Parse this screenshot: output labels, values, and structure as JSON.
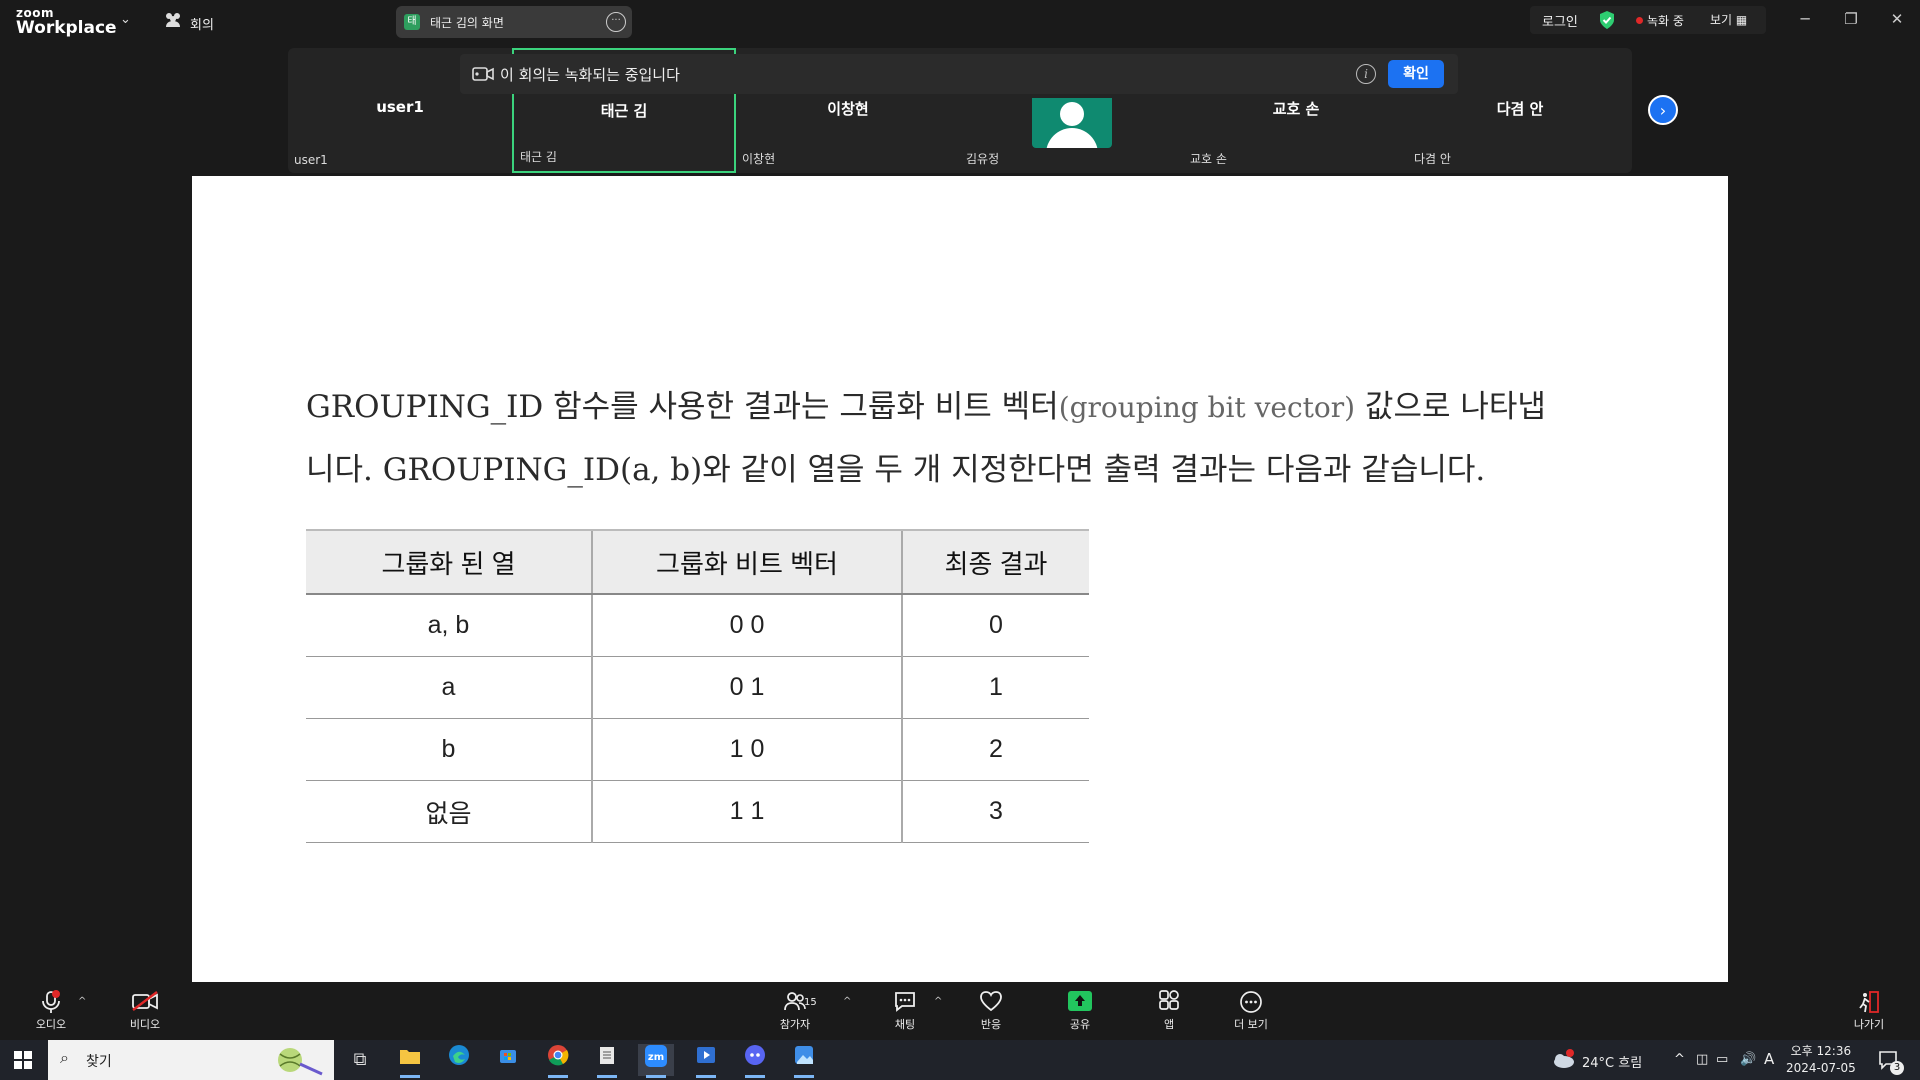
{
  "app": {
    "logo_top": "zoom",
    "logo_bottom": "Workplace",
    "meetings_label": "회의",
    "share_title": "태근 김의 화면",
    "share_badge": "태",
    "login": "로그인",
    "recording": "녹화 중",
    "view": "보기"
  },
  "participants": [
    {
      "name": "user1",
      "label": "user1"
    },
    {
      "name": "태근 김",
      "label": "태근 김"
    },
    {
      "name": "이창현",
      "label": "이창현"
    },
    {
      "name": "",
      "label": "김유정"
    },
    {
      "name": "교호 손",
      "label": "교호 손"
    },
    {
      "name": "다겸 안",
      "label": "다겸 안"
    }
  ],
  "banner": {
    "text": "이 회의는 녹화되는 중입니다",
    "confirm": "확인"
  },
  "content": {
    "line1_a": "GROUPING_ID 함수를 사용한 결과는 그룹화 비트 벡터",
    "line1_b": "(grouping bit vector)",
    "line1_c": " 값으로 나타냅",
    "line2": "니다. GROUPING_ID(a, b)와 같이 열을 두 개 지정한다면 출력 결과는 다음과 같습니다.",
    "table": {
      "headers": [
        "그룹화 된 열",
        "그룹화 비트 벡터",
        "최종 결과"
      ],
      "rows": [
        [
          "a, b",
          "0 0",
          "0"
        ],
        [
          "a",
          "0 1",
          "1"
        ],
        [
          "b",
          "1 0",
          "2"
        ],
        [
          "없음",
          "1 1",
          "3"
        ]
      ]
    }
  },
  "toolbar": {
    "audio": "오디오",
    "video": "비디오",
    "participants": "참가자",
    "participants_count": "15",
    "chat": "채팅",
    "reactions": "반응",
    "share": "공유",
    "apps": "앱",
    "more": "더 보기",
    "leave": "나가기"
  },
  "taskbar": {
    "search": "찾기",
    "weather": "24°C 흐림",
    "time": "오후 12:36",
    "date": "2024-07-05",
    "notif_count": "3",
    "ime": "A"
  },
  "colors": {
    "accent": "#1c72f2",
    "active_border": "#3bd37d",
    "record": "#e02828"
  }
}
